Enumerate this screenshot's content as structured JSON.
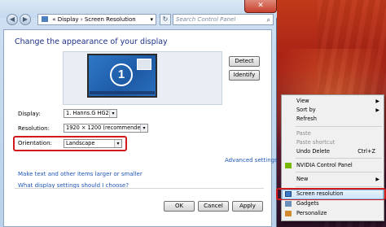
{
  "window": {
    "address": {
      "parts": [
        "«",
        "Display",
        "›",
        "Screen Resolution",
        "▾"
      ]
    },
    "search_placeholder": "Search Control Panel",
    "close_glyph": "✕"
  },
  "page": {
    "title": "Change the appearance of your display",
    "monitor_number": "1",
    "detect_label": "Detect",
    "identify_label": "Identify",
    "display_label": "Display:",
    "display_value": "1. Hanns.G HG281",
    "resolution_label": "Resolution:",
    "resolution_value": "1920 × 1200 (recommended)",
    "orientation_label": "Orientation:",
    "orientation_value": "Landscape",
    "advanced_link": "Advanced settings",
    "link_text_size": "Make text and other items larger or smaller",
    "link_display_settings": "What display settings should I choose?",
    "ok_label": "OK",
    "cancel_label": "Cancel",
    "apply_label": "Apply"
  },
  "context_menu": {
    "items": [
      {
        "label": "View",
        "submenu": true
      },
      {
        "label": "Sort by",
        "submenu": true
      },
      {
        "label": "Refresh"
      },
      {
        "label": "Paste",
        "disabled": true
      },
      {
        "label": "Paste shortcut",
        "disabled": true
      },
      {
        "label": "Undo Delete",
        "shortcut": "Ctrl+Z"
      },
      {
        "label": "NVIDIA Control Panel"
      },
      {
        "label": "New",
        "submenu": true
      },
      {
        "label": "Screen resolution"
      },
      {
        "label": "Gadgets"
      },
      {
        "label": "Personalize"
      }
    ]
  },
  "colors": {
    "highlight_box": "#d11a1a",
    "link": "#1f56b5",
    "title": "#1e3287"
  }
}
